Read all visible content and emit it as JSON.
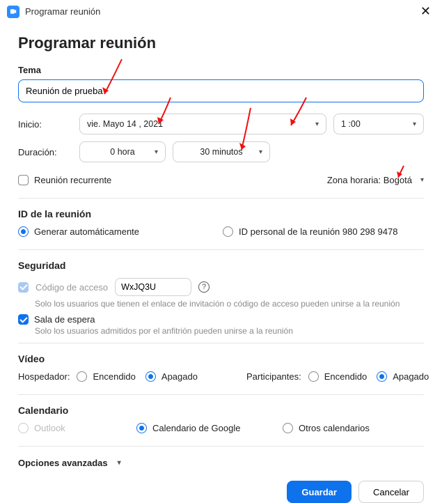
{
  "titlebar": {
    "title": "Programar reunión"
  },
  "header": "Programar reunión",
  "topic": {
    "label": "Tema",
    "value": "Reunión de prueba"
  },
  "start": {
    "label": "Inicio:",
    "date": "vie.  Mayo  14 ,  2021",
    "time": "1 :00"
  },
  "duration": {
    "label": "Duración:",
    "hours": "0 hora",
    "minutes": "30 minutos"
  },
  "recurring": {
    "label": "Reunión recurrente"
  },
  "timezone": {
    "text": "Zona horaria: Bogotá"
  },
  "meetingId": {
    "header": "ID de la reunión",
    "auto": "Generar automáticamente",
    "personal": "ID personal de la reunión 980 298 9478"
  },
  "security": {
    "header": "Seguridad",
    "passcode_label": "Código de acceso",
    "passcode_value": "WxJQ3U",
    "passcode_help": "Solo los usuarios que tienen el enlace de invitación o código de acceso pueden unirse a la reunión",
    "waiting_label": "Sala de espera",
    "waiting_help": "Solo los usuarios admitidos por el anfitrión pueden unirse a la reunión"
  },
  "video": {
    "header": "Vídeo",
    "host": "Hospedador:",
    "participants": "Participantes:",
    "on": "Encendido",
    "off": "Apagado"
  },
  "calendar": {
    "header": "Calendario",
    "outlook": "Outlook",
    "google": "Calendario de Google",
    "other": "Otros calendarios"
  },
  "advanced": "Opciones avanzadas",
  "buttons": {
    "save": "Guardar",
    "cancel": "Cancelar"
  }
}
